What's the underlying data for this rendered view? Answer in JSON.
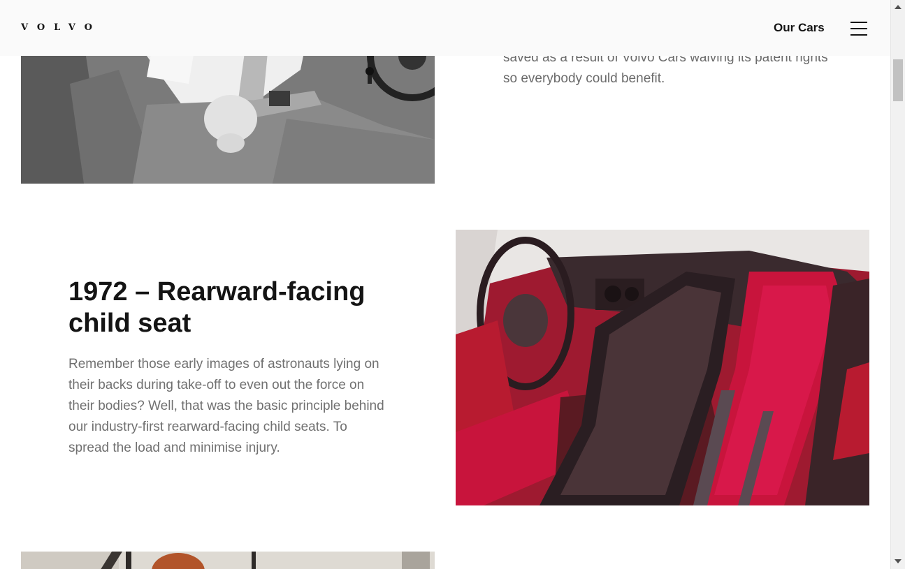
{
  "header": {
    "logo": "VOLVO",
    "nav_our_cars": "Our Cars",
    "menu_icon": "hamburger-menu-icon"
  },
  "previous_section": {
    "text": "saved as a result of Volvo Cars waiving its patent rights so everybody could benefit."
  },
  "section_1972": {
    "title": "1972 – Rearward-facing child seat",
    "description": "Remember those early images of astronauts lying on their backs during take-off to even out the force on their bodies? Well, that was the basic principle behind our industry-first rearward-facing child seats. To spread the load and minimise injury."
  },
  "colors": {
    "text_dark": "#141414",
    "text_body": "#707070",
    "header_bg": "#fafafa",
    "seat_red": "#c8143c"
  }
}
